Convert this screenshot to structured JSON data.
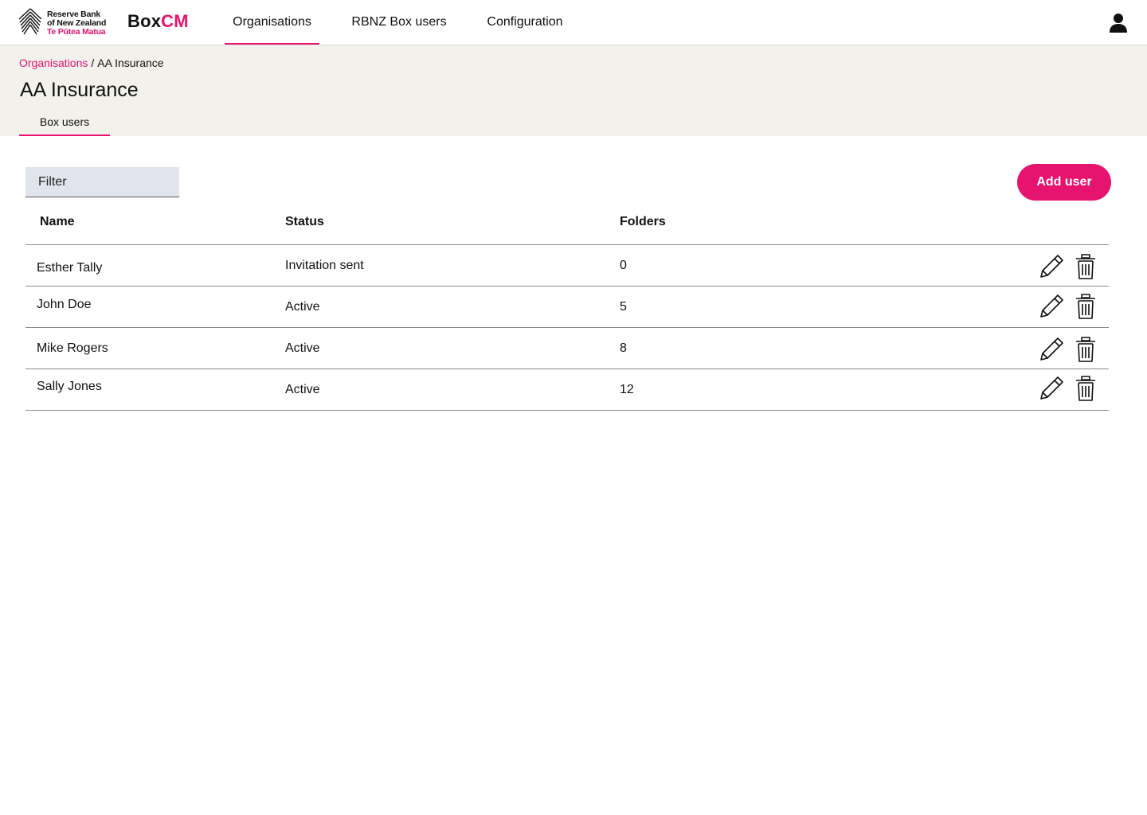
{
  "header": {
    "logo": {
      "line1": "Reserve Bank",
      "line2": "of New Zealand",
      "line3": "Te Pūtea Matua"
    },
    "brand": {
      "part1": "Box",
      "part2": "CM"
    },
    "nav": [
      {
        "label": "Organisations",
        "active": true
      },
      {
        "label": "RBNZ Box users",
        "active": false
      },
      {
        "label": "Configuration",
        "active": false
      }
    ],
    "user_icon": "user-icon"
  },
  "breadcrumb": {
    "link": "Organisations",
    "separator": "/",
    "current": "AA Insurance"
  },
  "page": {
    "title": "AA Insurance",
    "tabs": [
      {
        "label": "Box users",
        "active": true
      }
    ]
  },
  "toolbar": {
    "filter_placeholder": "Filter",
    "add_user_label": "Add user"
  },
  "table": {
    "columns": [
      "Name",
      "Status",
      "Folders"
    ],
    "rows": [
      {
        "name": "Esther Tally",
        "status": "Invitation sent",
        "folders": "0"
      },
      {
        "name": "John Doe",
        "status": "Active",
        "folders": "5"
      },
      {
        "name": "Mike Rogers",
        "status": "Active",
        "folders": "8"
      },
      {
        "name": "Sally Jones",
        "status": "Active",
        "folders": "12"
      }
    ],
    "row_actions": [
      "pencil-icon",
      "trash-icon"
    ]
  },
  "colors": {
    "accent": "#e6136f",
    "subheader_bg": "#f2f1ec",
    "filter_bg": "#e1e4ec"
  }
}
